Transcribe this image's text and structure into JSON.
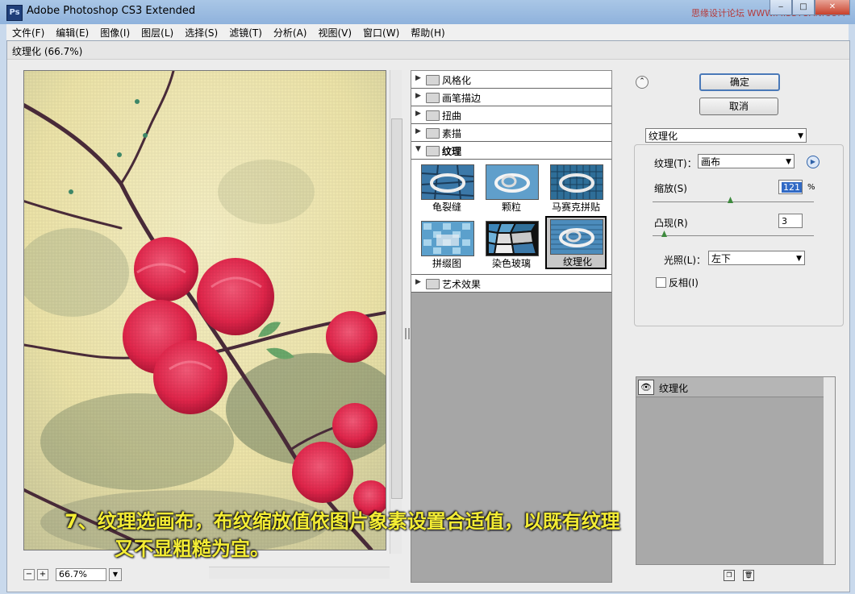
{
  "window": {
    "app_icon": "Ps",
    "title": "Adobe Photoshop CS3 Extended",
    "watermark": "思缘设计论坛 WWW.MISSYUAN.COM",
    "controls": [
      "minimize-icon",
      "maximize-icon",
      "close-icon"
    ]
  },
  "menu": {
    "items": [
      "文件(F)",
      "编辑(E)",
      "图像(I)",
      "图层(L)",
      "选择(S)",
      "滤镜(T)",
      "分析(A)",
      "视图(V)",
      "窗口(W)",
      "帮助(H)"
    ]
  },
  "dialog": {
    "title": "纹理化 (66.7%)",
    "zoom": "66.7%",
    "zoom_out_icon": "−",
    "zoom_in_icon": "+"
  },
  "gallery": {
    "folders_top": [
      {
        "label": "风格化",
        "open": false
      },
      {
        "label": "画笔描边",
        "open": false
      },
      {
        "label": "扭曲",
        "open": false
      },
      {
        "label": "素描",
        "open": false
      },
      {
        "label": "纹理",
        "open": true
      }
    ],
    "thumbnails": [
      {
        "label": "龟裂缝",
        "selected": false
      },
      {
        "label": "颗粒",
        "selected": false
      },
      {
        "label": "马赛克拼贴",
        "selected": false
      },
      {
        "label": "拼缀图",
        "selected": false
      },
      {
        "label": "染色玻璃",
        "selected": false
      },
      {
        "label": "纹理化",
        "selected": true
      }
    ],
    "folders_bottom": [
      {
        "label": "艺术效果",
        "open": false
      }
    ]
  },
  "buttons": {
    "ok": "确定",
    "cancel": "取消"
  },
  "filter_select": "纹理化",
  "controls": {
    "texture_label": "纹理(T)：",
    "texture_value": "画布",
    "scaling_label": "缩放(S)",
    "scaling_value": "121",
    "scaling_unit": "%",
    "scaling_slider_fraction": 0.48,
    "relief_label": "凸现(R)",
    "relief_value": "3",
    "relief_slider_fraction": 0.07,
    "light_label": "光照(L)：",
    "light_value": "左下",
    "invert_label": "反相(I)",
    "invert_checked": false
  },
  "layers": {
    "items": [
      "纹理化"
    ],
    "buttons": [
      "new-effect-layer-icon",
      "delete-effect-layer-icon"
    ]
  },
  "caption": {
    "line1": "7、纹理选画布，布纹缩放值依图片象素设置合适值，以既有纹理",
    "line2": "又不显粗糙为宜。"
  },
  "colors": {
    "caption": "#f3ec34",
    "flower": "#e8284a",
    "titlebar": "#9dbbe1"
  }
}
